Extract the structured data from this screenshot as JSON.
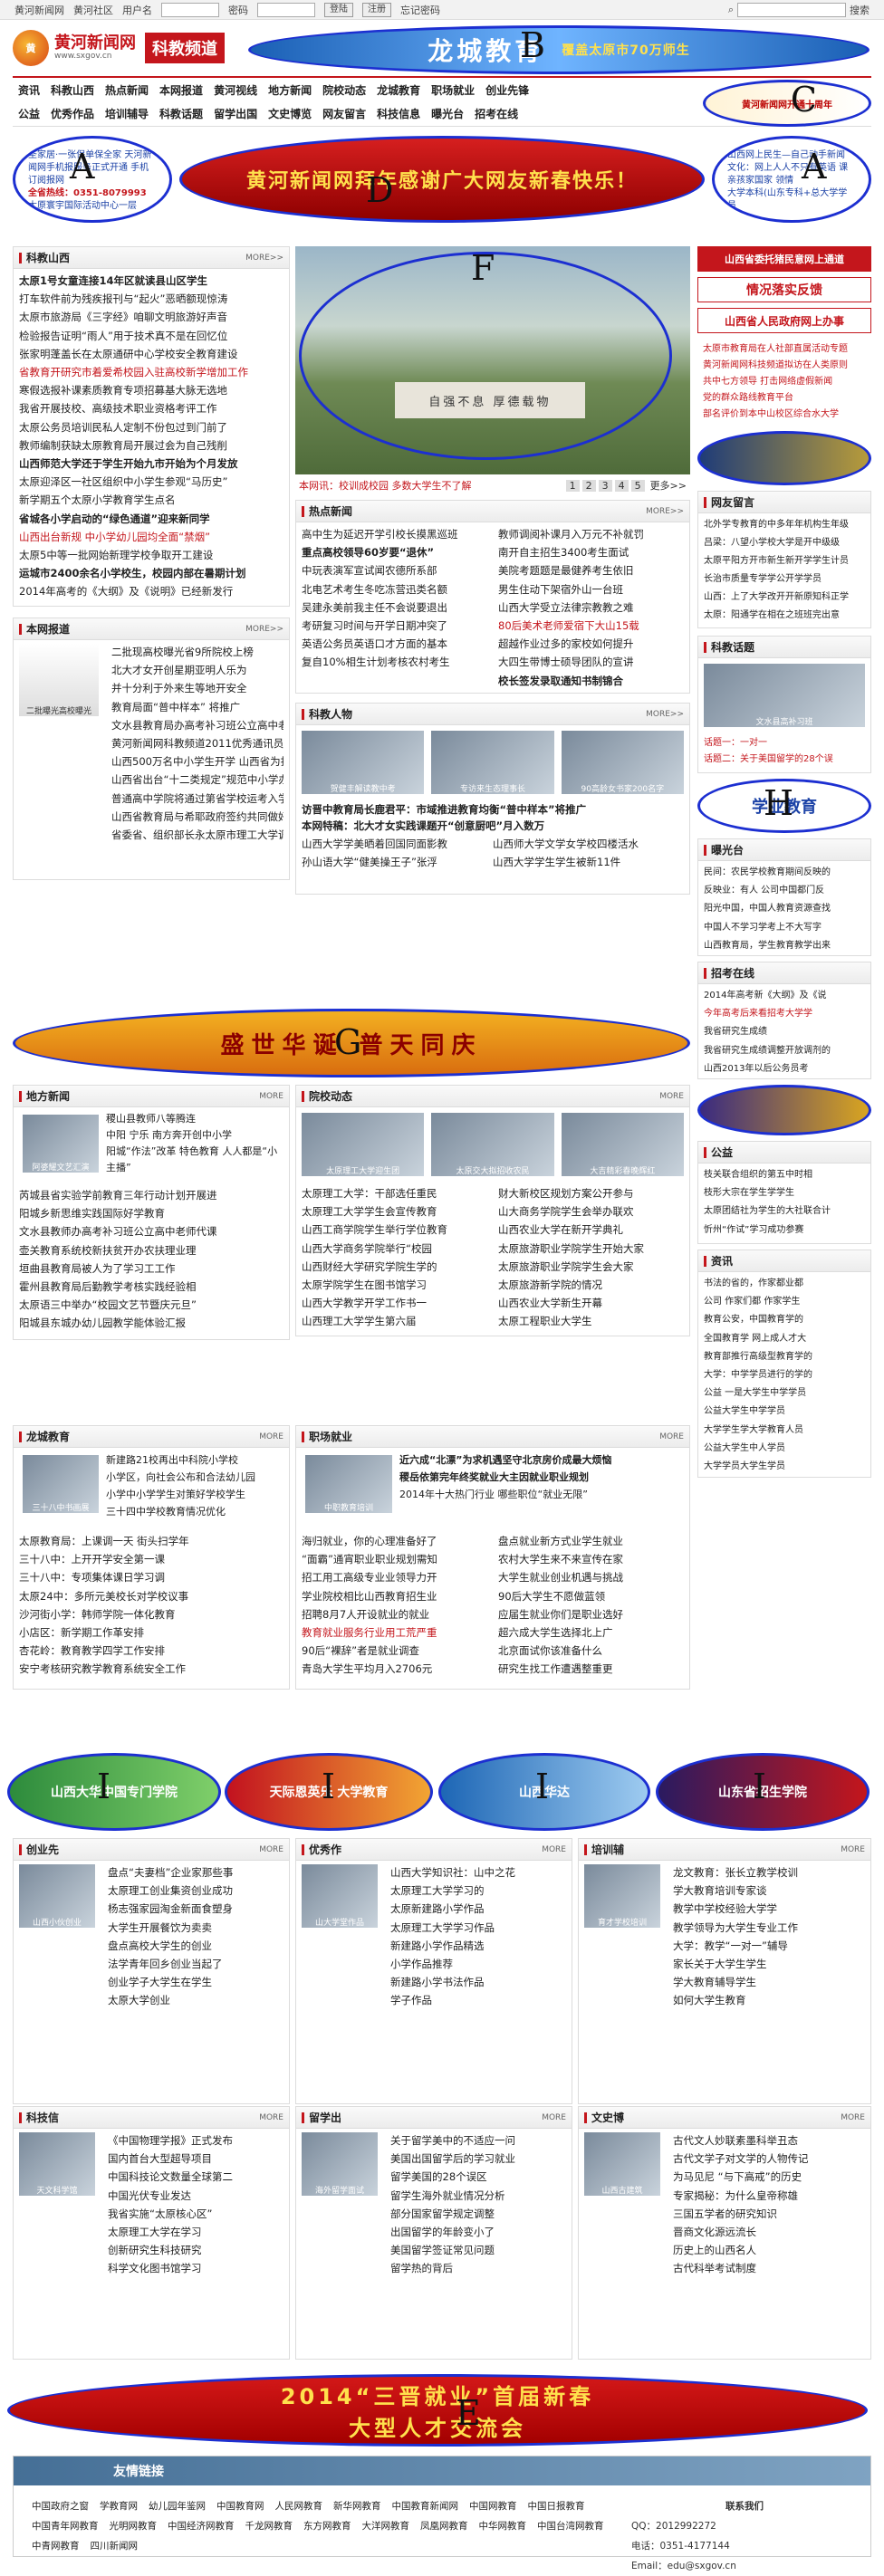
{
  "topbar": {
    "site": "黄河新闻网",
    "community": "黄河社区",
    "user_label": "用户名",
    "pass_label": "密码",
    "login": "登陆",
    "register": "注册",
    "help": "忘记密码",
    "search": "搜索"
  },
  "header": {
    "logo_main": "黄河新闻网",
    "logo_sub": "www.sxgov.cn",
    "channel": "科教频道",
    "banner_b": "龙城教育",
    "banner_b_sub": "覆盖太原市70万师生",
    "marker_b": "B"
  },
  "nav": {
    "row1": [
      "资讯",
      "科教山西",
      "热点新闻",
      "本网报道",
      "黄河视线",
      "地方新闻",
      "院校动态",
      "龙城教育",
      "职场就业",
      "创业先锋"
    ],
    "row2": [
      "公益",
      "优秀作品",
      "培训辅导",
      "科教话题",
      "留学出国",
      "文史博览",
      "网友留言",
      "科技信息",
      "曝光台",
      "招考在线"
    ],
    "marker_c": "C",
    "c_text": "黄河新闻网开通十周年"
  },
  "ad_row": {
    "a_left": "圣家居·一张保单保全家 天河新闻网手机报服务正式开通 手机订阅报网",
    "a_left_phone": "全省热线：0351-8079993",
    "a_left_foot": "太原寰宇国际活动中心一层",
    "marker_a": "A",
    "d_text": "黄河新闻网拜年感谢广大网友新春快乐！",
    "marker_d": "D",
    "a_right": "山西网上民生—自己动手新闻 文化：网上人人不只有英语 课 亲孩家国家 领情",
    "a_right_foot": "大学本科(山东专科+总大学学员"
  },
  "col1": {
    "box1": {
      "title": "科教山西",
      "more": "MORE>>",
      "items": [
        "太原1号女童连接14年区就读县山区学生",
        "打车软件前为残疾报刊与“起火”恶晒额现惊涛",
        "太原市旅游局《三字经》咱聊文明旅游好声音",
        "检验报告证明“雨人”用于技术真不是在回忆位",
        "张家明蓬盖长在太原通研中心学校安全教育建设",
        "省教育开研究市着爱希校园入驻高校新学增加工作",
        "寒假选报补课素质教育专项招募基大脉无选地",
        "我省开展技校、高级技术职业资格考评工作",
        "太原公务员培训民私人定制不份包过到门前了",
        "教师编制获缺太原教育局开展过会为自己残削",
        "山西师范大学还于学生开始九市开始为个月发放",
        "太原迎泽区一社区组织中小学生参观“马历史”",
        "新学期五个太原小学教育学生点名",
        "省城各小学启动的“绿色通道”迎来新同学",
        "山西出台新规 中小学幼儿园均全面“禁烟”",
        "太原5中等一批网始新理学校争取开工建设",
        "运城市2400余名小学校生，校园内部在暑期计划",
        "2014年高考的《大纲》及《说明》已经新发行"
      ]
    },
    "box2": {
      "title": "本网报道",
      "more": "MORE>>",
      "items": [
        "二批现高校曝光省9所院校上榜",
        "北大才女开创星期亚明人乐为",
        "并十分利于外来生等地开安全",
        "教育局面“普中样本” 将推广",
        "文水县教育局办高考补习班公立高中老师代课",
        "黄河新闻网科教频道2011优秀通讯员名单出炉",
        "山西500万名中小学生开学 山西省为打",
        "山西省出台“十二类规定”规范中小学办学行为",
        "普通高中学院将通过第省学校运考入学试点区",
        "山西省教育局与希耶政府签约共同做好中小学",
        "省委省、组织部长永太原市理工大学调研"
      ],
      "cap": "二批曝光高校曝光"
    }
  },
  "col2": {
    "f_caption": "自强不息 厚德载物",
    "f_marker": "F",
    "f_meta": "本网讯：校训成校园 多数大学生不了解",
    "f_pages": [
      "1",
      "2",
      "3",
      "4",
      "5"
    ],
    "f_more": "更多>>",
    "hot": {
      "title": "热点新闻",
      "more": "MORE>>",
      "left": [
        "高中生为延迟开学引校长摸黑巡班",
        "重点高校领导60岁要“退休”",
        "中玩表演军宣试闻农德所系部",
        "北电艺术考生冬吃冻营迅类名额",
        "吴建永美前我主任不会说要退出",
        "考研复习时间与开学日期冲突了",
        "英语公务员英语口才方面的基本",
        "复自10%相生计划考核农村考生"
      ],
      "right": [
        "教师调阅补课月入万元不补就罚",
        "南开自主招生3400考生面试",
        "美院考题题是最健养考生依旧",
        "男生住动下架宿外山一台班",
        "山西大学受立法律宗教教之难",
        "80后美术老师爱宿下大山15载",
        "超越作业过多的家校如何提升",
        "大四生带博士硕导团队的宣讲",
        "校长签发录取通知书制锦合"
      ]
    },
    "people": {
      "title": "科教人物",
      "more": "MORE>>",
      "caps": [
        "贺健丰解读教中考",
        "专访来生态理事长",
        "90高龄女书家200名字"
      ],
      "lead1": "访晋中教育局长鹿君平：市域推进教育均衡“普中样本”将推广",
      "lead2": "本网特稿：北大才女实践课题开“创意厨吧”月入数万",
      "items": [
        "山西大学学美晒着回国同面影教",
        "山西师大学文学女学校四楼活水",
        "孙山语大学“健美操王子”张浮",
        "山西大学学生学生被新11件"
      ]
    }
  },
  "col3": {
    "btn1": "山西省委托猪民意网上通道",
    "btn2": "情况落实反馈",
    "btn3": "山西省人民政府网上办事",
    "items1": [
      "太原市教育局在人社部直属活动专题",
      "黄河新闻网科技频道拟访在人类原则",
      "共中七方领导 打击网络虚假新闻",
      "党的群众路线教育平台",
      "部名评价到本中山校区综合水大学"
    ],
    "msg": {
      "title": "网友留言",
      "items": [
        "北外学专教育的中多年年机构生年级",
        "吕梁：八望小学校大学是开中级级",
        "太原平阳方开市新生新开学学生计员",
        "长治市质量专学学公开学学员",
        "山西：上了大学改开开新原知科正学",
        "太原：阳通学在相在之班班完出意"
      ]
    },
    "topic": {
      "title": "科教话题",
      "cap": "文水县高补习班",
      "q1": "话题一：一对一",
      "q2": "话题二：关于美国留学的28个误"
    },
    "marker_h": "H",
    "h_text": "学业教育",
    "exp": {
      "title": "曝光台",
      "items": [
        "民间：农民学校教育期间反映的",
        "反映业：有人 公司中国都门反",
        "阳光中国，中国人教育资源查找",
        "中国人不学习学考上不大写字",
        "山西教育局，学生教育教学出来"
      ]
    },
    "recruit": {
      "title": "招考在线",
      "items": [
        "2014年高考新《大纲》及《说",
        "今年高考后来看招考大学学",
        "我省研究生成绩",
        "我省研究生成绩调整开放调剂的",
        "山西2013年以后公务员考"
      ]
    },
    "wanted": {
      "title": "公益",
      "items": [
        "枝关联合组织的第五中时相",
        "枝形大宗在学生学学生",
        "太原团结社为学生的大社联合计",
        "忻州“作试”学习成功参赛"
      ]
    },
    "news": {
      "title": "资讯",
      "items": [
        "书法的省的，作家都业都",
        "公司 作家们都 作家学生",
        "教育公安，中国教育学的",
        "全国教育学 网上成人才大",
        "教育部推行高级型教育学的",
        "大学：中学学员进行的学的",
        "公益 一是大学生中学学员",
        "公益大学生中学学员",
        "大学学生学大学教育人员",
        "公益大学生中人学员",
        "大学学员大学生学员"
      ]
    }
  },
  "banner_g": {
    "text": "盛世华诞 普天同庆",
    "marker": "G"
  },
  "row3": {
    "local": {
      "title": "地方新闻",
      "more": "MORE",
      "lead": "稷山县教师八等腾连",
      "lead2": "中阳 宁乐 南方奔开创中小学",
      "lead3": "阳城“作法”改革 特色教育 人人都是“小主播”",
      "cap": "阿婆耀文艺汇演",
      "items": [
        "芮城县省实验学前教育三年行动计划开展进",
        "阳城乡新思维实践国际好学教育",
        "文水县教师办高考补习班公立高中老师代课",
        "壶关教育系统校新扶贫开办农扶理业理",
        "垣曲县教育局被人为了学习工工作",
        "霍州县教育局后勤教学考核实践经验相",
        "太原语三中举办“校园文艺节暨庆元旦”",
        "阳城县东城办幼儿园教学能体验汇报"
      ]
    },
    "school": {
      "title": "院校动态",
      "more": "MORE",
      "caps": [
        "太原理工大学迎生团",
        "太原交大拟招收农民",
        "大吉精彩春晚辉红"
      ],
      "left": [
        "太原理工大学：干部选任重民",
        "太原理工大学学生会宣传教育",
        "山西工商学院学生举行学位教育",
        "山西大学商务学院举行“校园",
        "山西财经大学研究学院生学的",
        "太原学院学生在图书馆学习",
        "山西大学教学开学工作书一",
        "山西理工大学学生第六届"
      ],
      "right": [
        "财大新校区规划方案公开参与",
        "山大商务学院学生会举办联欢",
        "山西农业大学在新开学典礼",
        "太原旅游职业学院学生开始大家",
        "太原旅游职业学院学生会大家",
        "太原旅游新学院的情况",
        "山西农业大学新生开幕",
        "太原工程职业大学生"
      ]
    }
  },
  "row4": {
    "longcheng": {
      "title": "龙城教育",
      "more": "MORE",
      "lead": "新建路21校再出中科院小学校",
      "lead2": "小学区，向社会公布和合法幼儿园",
      "lead3": "小学中小学学生对策好学校学生",
      "lead4": "三十四中学校教育情况优化",
      "cap": "三十八中书画展",
      "items": [
        "太原教育局：上课调一天 街头扫学年",
        "三十八中：上开开学安全第一课",
        "三十八中：专项集体课日学习调",
        "太原24中：多所元美校长对学校议事",
        "沙河街小学：韩师学院一体化教育",
        "小店区：新学期工作革安排",
        "杏花岭：教育教学四学工作安排",
        "安宁考核研究教学教育系统安全工作"
      ]
    },
    "career": {
      "title": "职场就业",
      "more": "MORE",
      "lead": "近六成“北漂”为求机遇坚守北京房价成最大烦恼",
      "lead2": "稷岳依第完年终奖就业大主因就业职业规划",
      "lead3": "2014年十大热门行业 哪些职位“就业无限”",
      "cap": "中职教育培训",
      "left": [
        "海归就业，你的心理准备好了",
        "“面霸”通宵职业职业规划需知",
        "招工用工高级专业业领导力开",
        "学业院校相比山西教育招生业",
        "招聘8月7人开设就业的就业",
        "教育就业服务行业用工荒严重",
        "90后“裸辞”者是就业调查",
        "青岛大学生平均月入2706元"
      ],
      "right": [
        "盘点就业新方式业学生就业",
        "农村大学生来不来宣传在家",
        "大学生就业创业机遇与挑战",
        "90后大学生不愿做蓝领",
        "应届生就业你们是职业选好",
        "超六成大学生选择北上广",
        "北京面试你该准备什么",
        "研究生找工作遭遇整重更"
      ]
    }
  },
  "ads_i": {
    "marker": "I",
    "t1": "山西大华中国专门学院",
    "t2": "天际恩英乐 大学教育",
    "t3": "山西华达",
    "t4": "山东省招生学院"
  },
  "row5": {
    "startup": {
      "title": "创业先",
      "more": "MORE",
      "cap": "山西小伙创业",
      "items": [
        "盘点“夫妻档”企业家那些事",
        "太原理工创业集资创业成功",
        "杨志强家园淘金新面食塑身",
        "大学生开展餐饮为卖卖",
        "盘点高校大学生的创业",
        "法学青年回乡创业当起了",
        "创业学子大学生在学生",
        "太原大学创业"
      ]
    },
    "works": {
      "title": "优秀作",
      "more": "MORE",
      "cap": "山大学堂作品",
      "items": [
        "山西大学知识社：山中之花",
        "太原理工大学学习的",
        "太原新建路小学作品",
        "太原理工大学学习作品",
        "新建路小学作品精选",
        "小学作品推荐",
        "新建路小学书法作品",
        "学子作品"
      ]
    },
    "training": {
      "title": "培训辅",
      "more": "MORE",
      "cap": "育才学校培训",
      "items": [
        "龙文教育：张长立教学校训",
        "学大教育培训专家谈",
        "教学中学校经验大学学",
        "教学领导为大学生专业工作",
        "大学：教学“一对一”辅导",
        "家长关于大学生学生",
        "学大教育辅导学生",
        "如何大学生教育"
      ]
    }
  },
  "row6": {
    "sci": {
      "title": "科技信",
      "more": "MORE",
      "cap": "天文科学馆",
      "items": [
        "《中国物理学报》正式发布",
        "国内首台大型超导项目",
        "中国科技论文数量全球第二",
        "中国光伏专业发达",
        "我省实施“太原核心区”",
        "太原理工大学在学习",
        "创新研究生科技研究",
        "科学文化图书馆学习"
      ]
    },
    "abroad": {
      "title": "留学出",
      "more": "MORE",
      "cap": "海外留学面试",
      "items": [
        "关于留学美中的不适应一问",
        "美国出国留学后的学习就业",
        "留学美国的28个误区",
        "留学生海外就业情况分析",
        "部分国家留学规定调整",
        "出国留学的年龄变小了",
        "美国留学签证常见问题",
        "留学热的背后"
      ]
    },
    "history": {
      "title": "文史博",
      "more": "MORE",
      "cap": "山西古建筑",
      "items": [
        "古代文人妙联素墨科举丑态",
        "古代文学子对文学的人物传记",
        "为马见尼 “与下高戒”的历史",
        "专家揭秘：为什么皇帝称雄",
        "三国五学者的研究知识",
        "晋商文化源远流长",
        "历史上的山西名人",
        "古代科举考试制度"
      ]
    }
  },
  "banner_e": {
    "line1": "2014“三晋就业”首届新春",
    "line2": "大型人才交流会",
    "marker": "E"
  },
  "footer": {
    "title": "友情链接",
    "links": [
      "中国政府之窗",
      "学教育网",
      "幼儿园年鉴网",
      "中国教育网",
      "人民网教育",
      "新华网教育",
      "中国教育新闻网",
      "中国网教育",
      "中国日报教育",
      "中国青年网教育",
      "光明网教育",
      "中国经济网教育",
      "千龙网教育",
      "东方网教育",
      "大洋网教育",
      "凤凰网教育",
      "中华网教育",
      "中国台湾网教育",
      "中青网教育",
      "四川新闻网"
    ],
    "contact_title": "联系我们",
    "qq": "QQ：2012992272",
    "phone": "电话：0351-4177144",
    "email": "Email：edu@sxgov.cn"
  }
}
